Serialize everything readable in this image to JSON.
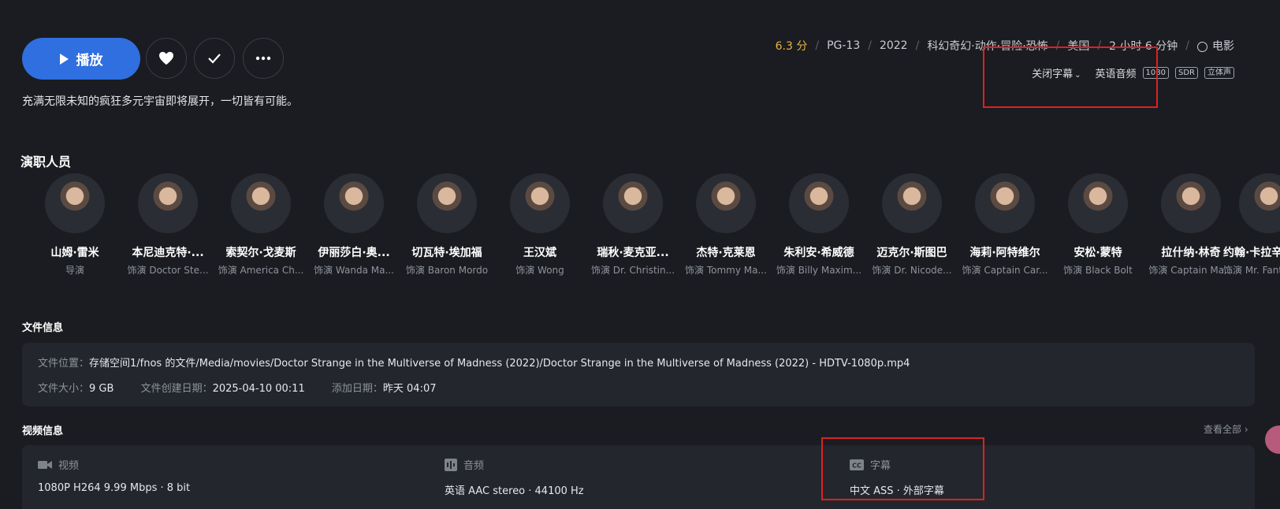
{
  "actions": {
    "play_label": "播放",
    "like_icon": "heart-icon",
    "done_icon": "check-icon",
    "more_icon": "more-icon"
  },
  "tagline": "充满无限未知的疯狂多元宇宙即将展开，一切皆有可能。",
  "meta": {
    "score": "6.3 分",
    "rating": "PG-13",
    "year": "2022",
    "genres": "科幻奇幻·动作·冒险·恐怖",
    "country": "美国",
    "duration": "2 小时 6 分钟",
    "type": "电影"
  },
  "media_options": {
    "subtitle_select": "关闭字幕",
    "audio": "英语音频",
    "badges": [
      "1080",
      "SDR",
      "立体声"
    ]
  },
  "cast": {
    "title": "演职人员",
    "people": [
      {
        "name": "山姆·雷米",
        "role": "导演"
      },
      {
        "name": "本尼迪克特·...",
        "role": "饰演 Doctor Ste..."
      },
      {
        "name": "索契尔·戈麦斯",
        "role": "饰演 America Ch..."
      },
      {
        "name": "伊丽莎白·奥...",
        "role": "饰演 Wanda Ma..."
      },
      {
        "name": "切瓦特·埃加福",
        "role": "饰演 Baron Mordo"
      },
      {
        "name": "王汉斌",
        "role": "饰演 Wong"
      },
      {
        "name": "瑞秋·麦克亚...",
        "role": "饰演 Dr. Christin..."
      },
      {
        "name": "杰特·克莱恩",
        "role": "饰演 Tommy Ma..."
      },
      {
        "name": "朱利安·希威德",
        "role": "饰演 Billy Maxim..."
      },
      {
        "name": "迈克尔·斯图巴",
        "role": "饰演 Dr. Nicode..."
      },
      {
        "name": "海莉·阿特维尔",
        "role": "饰演 Captain Car..."
      },
      {
        "name": "安松·蒙特",
        "role": "饰演 Black Bolt"
      },
      {
        "name": "拉什纳·林奇",
        "role": "饰演 Captain Ma..."
      },
      {
        "name": "约翰·卡拉辛",
        "role": "饰演 Mr. Fant"
      }
    ]
  },
  "file_info": {
    "title": "文件信息",
    "location_label": "文件位置：",
    "location": "存储空间1/fnos 的文件/Media/movies/Doctor Strange in the Multiverse of Madness (2022)/Doctor Strange in the Multiverse of Madness (2022) - HDTV-1080p.mp4",
    "size_label": "文件大小：",
    "size": "9 GB",
    "created_label": "文件创建日期：",
    "created": "2025-04-10 00:11",
    "added_label": "添加日期：",
    "added": "昨天 04:07"
  },
  "video_info": {
    "title": "视频信息",
    "view_all": "查看全部",
    "video_label": "视频",
    "video_value": "1080P H264 9.99 Mbps · 8 bit",
    "audio_label": "音频",
    "audio_value": "英语 AAC stereo · 44100 Hz",
    "subtitle_label": "字幕",
    "subtitle_value": "中文 ASS · 外部字幕"
  }
}
